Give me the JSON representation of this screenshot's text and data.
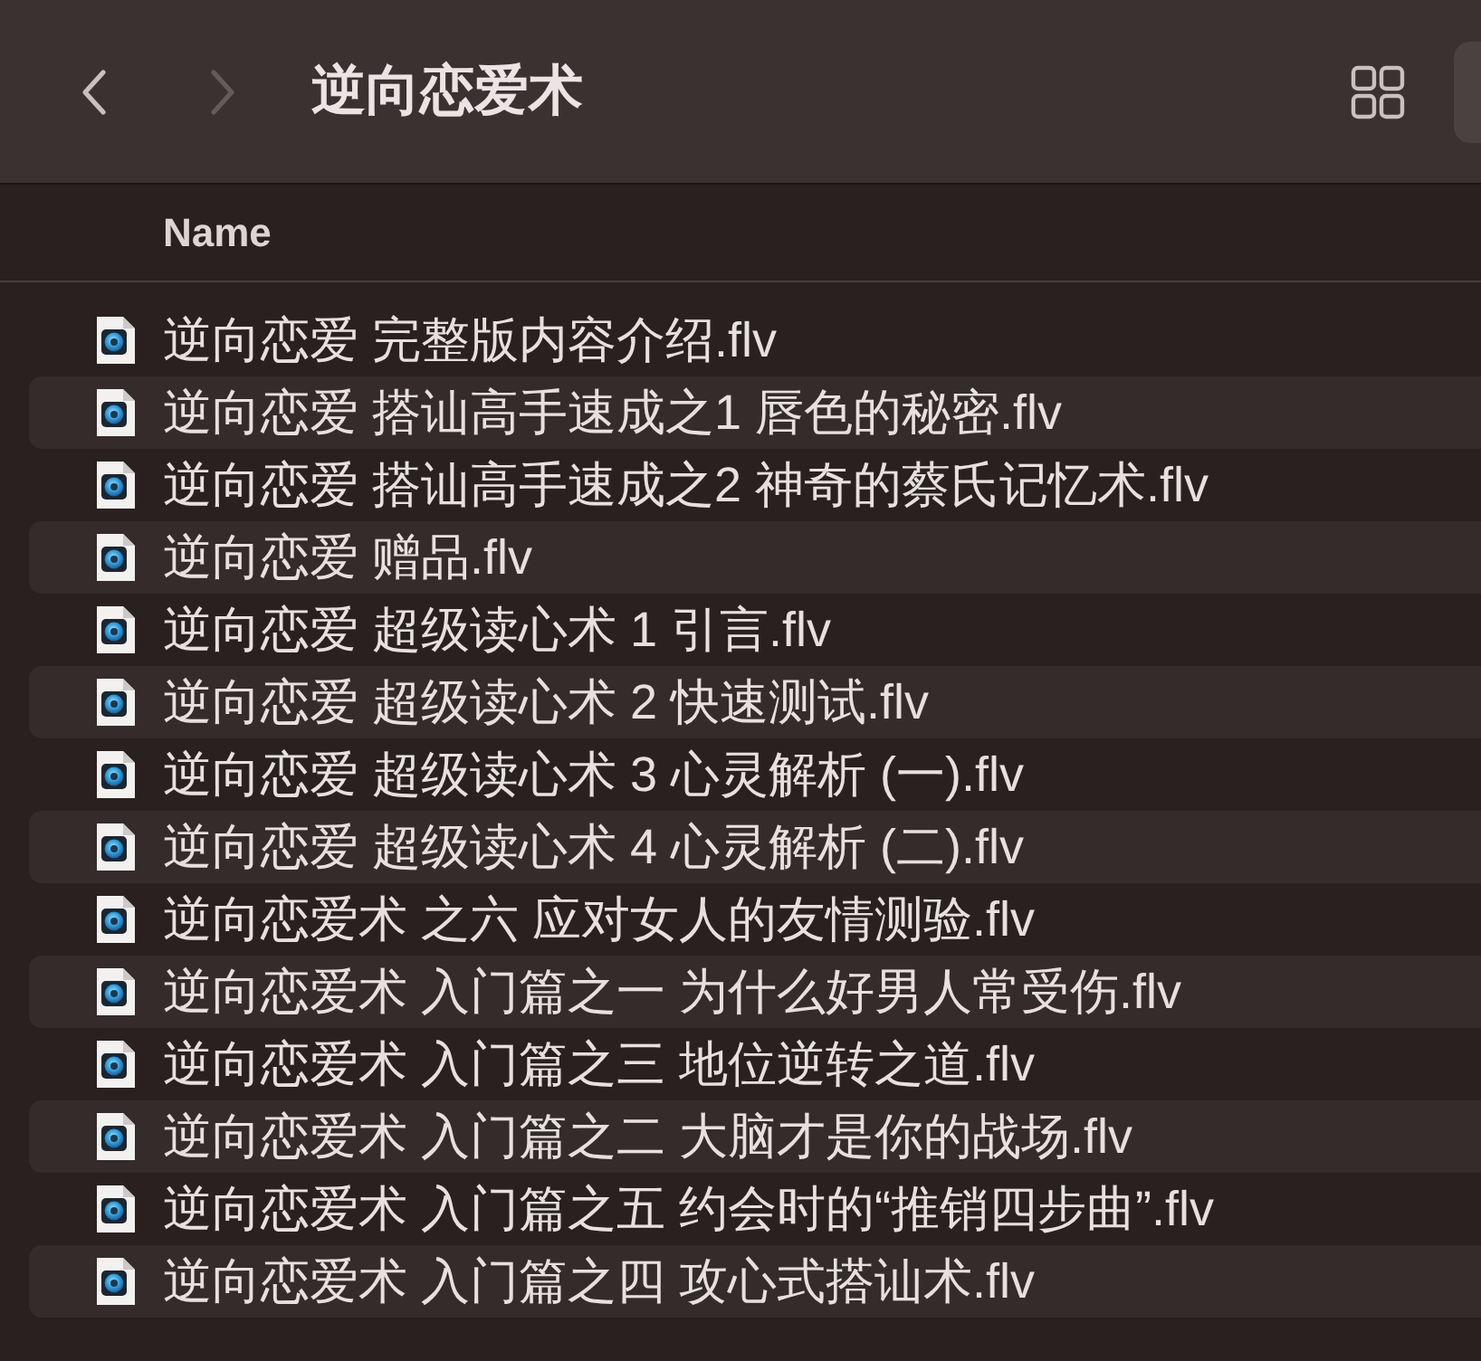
{
  "toolbar": {
    "navigation": [
      {
        "kind": "back",
        "disabled": false
      },
      {
        "kind": "forward",
        "disabled": true
      }
    ],
    "title": "逆向恋爱术"
  },
  "list": {
    "columns": [
      {
        "label": "Name"
      }
    ],
    "rows": [
      {
        "name": "逆向恋爱 完整版内容介绍.flv"
      },
      {
        "name": "逆向恋爱 搭讪高手速成之1 唇色的秘密.flv"
      },
      {
        "name": "逆向恋爱 搭讪高手速成之2 神奇的蔡氏记忆术.flv"
      },
      {
        "name": "逆向恋爱 赠品.flv"
      },
      {
        "name": "逆向恋爱 超级读心术 1 引言.flv"
      },
      {
        "name": "逆向恋爱 超级读心术 2 快速测试.flv"
      },
      {
        "name": "逆向恋爱 超级读心术 3 心灵解析 (一).flv"
      },
      {
        "name": "逆向恋爱 超级读心术 4 心灵解析 (二).flv"
      },
      {
        "name": "逆向恋爱术 之六 应对女人的友情测验.flv"
      },
      {
        "name": "逆向恋爱术 入门篇之一 为什么好男人常受伤.flv"
      },
      {
        "name": "逆向恋爱术 入门篇之三 地位逆转之道.flv"
      },
      {
        "name": "逆向恋爱术 入门篇之二 大脑才是你的战场.flv"
      },
      {
        "name": "逆向恋爱术 入门篇之五 约会时的“推销四步曲”.flv"
      },
      {
        "name": "逆向恋爱术 入门篇之四 攻心式搭讪术.flv"
      }
    ]
  }
}
